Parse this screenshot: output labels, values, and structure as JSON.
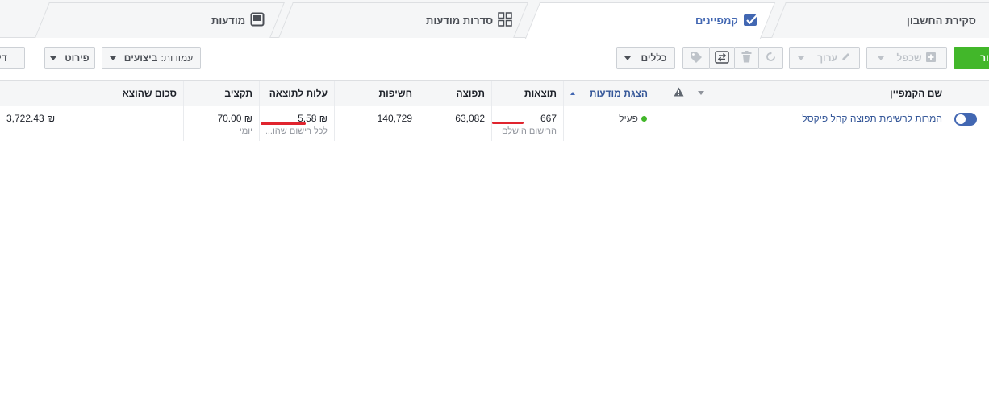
{
  "tabs": {
    "account": "סקירת החשבון",
    "campaigns": "קמפיינים",
    "adsets": "סדרות מודעות",
    "ads": "מודעות"
  },
  "toolbar": {
    "create_label": "צור",
    "duplicate_label": "שכפל",
    "edit_label": "ערוך",
    "rules_label": "כללים",
    "columns_label": "עמודות:",
    "columns_value": "ביצועים",
    "breakdown_label": "פירוט",
    "reports_label": "דיוו"
  },
  "table": {
    "headers": {
      "name": "שם הקמפיין",
      "delivery": "הצגת מודעות",
      "results": "תוצאות",
      "reach": "תפוצה",
      "impressions": "חשיפות",
      "cost_per_result": "עלות לתוצאה",
      "budget": "תקציב",
      "amount_spent": "סכום שהוצא"
    },
    "rows": [
      {
        "name": "המרות לרשימת תפוצה קהל פיקסל",
        "delivery": "פעיל",
        "results": "667",
        "results_sub": "הרישום הושלם",
        "reach": "63,082",
        "impressions": "140,729",
        "cost_per_result": "₪ 5.58",
        "cost_per_result_sub": "לכל רישום שהו...",
        "budget": "₪ 70.00",
        "budget_sub": "יומי",
        "amount_spent": "₪ 3,722.43"
      }
    ]
  },
  "colors": {
    "accent": "#4267b2",
    "green": "#42b72a",
    "annotation_red": "#e0242e"
  }
}
